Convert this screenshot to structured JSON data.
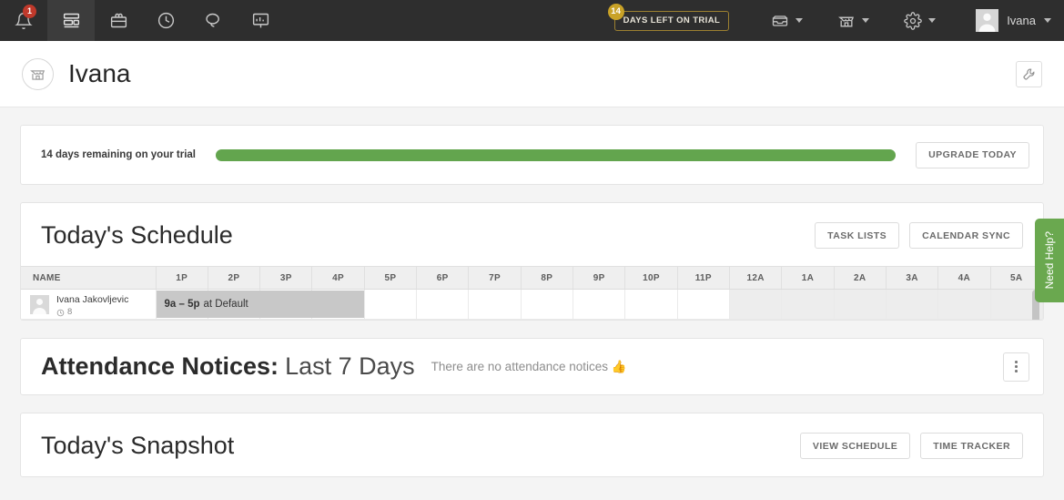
{
  "navbar": {
    "notifications": {
      "icon": "bell-icon",
      "count": "1"
    },
    "items": [
      {
        "icon": "dashboard-icon",
        "active": true
      },
      {
        "icon": "toolbox-icon",
        "active": false
      },
      {
        "icon": "clock-icon",
        "active": false
      },
      {
        "icon": "chat-icon",
        "active": false
      },
      {
        "icon": "reports-icon",
        "active": false
      }
    ],
    "trial": {
      "count": "14",
      "label": "DAYS LEFT ON TRIAL"
    },
    "dropdowns": [
      {
        "icon": "inbox-icon"
      },
      {
        "icon": "store-icon"
      },
      {
        "icon": "gear-icon"
      }
    ],
    "user": {
      "name": "Ivana",
      "avatar": "user-avatar"
    }
  },
  "header": {
    "icon": "store-icon",
    "title": "Ivana",
    "action_icon": "wrench-icon"
  },
  "trial_banner": {
    "label": "14 days remaining on your trial",
    "progress_percent": 100,
    "fill_color": "#63a54e",
    "upgrade_label": "UPGRADE TODAY"
  },
  "schedule": {
    "title": "Today's Schedule",
    "buttons": [
      "TASK LISTS",
      "CALENDAR SYNC"
    ],
    "name_header": "NAME",
    "columns": [
      "1P",
      "2P",
      "3P",
      "4P",
      "5P",
      "6P",
      "7P",
      "8P",
      "9P",
      "10P",
      "11P",
      "12A",
      "1A",
      "2A",
      "3A",
      "4A",
      "5A"
    ],
    "shaded_from_index": 11,
    "rows": [
      {
        "name": "Ivana Jakovljevic",
        "hours_icon": "clock-icon",
        "hours": "8",
        "shift": {
          "time": "9a – 5p",
          "at": "at Default",
          "start_col": 0,
          "span_cols": 4
        }
      }
    ]
  },
  "attendance": {
    "title_strong": "Attendance Notices:",
    "title_light": "Last 7 Days",
    "note": "There are no attendance notices 👍",
    "menu_icon": "kebab-menu-icon"
  },
  "snapshot": {
    "title": "Today's Snapshot",
    "buttons": [
      "VIEW SCHEDULE",
      "TIME TRACKER"
    ]
  },
  "need_help": {
    "label": "Need Help?",
    "color": "#6aa84f"
  }
}
